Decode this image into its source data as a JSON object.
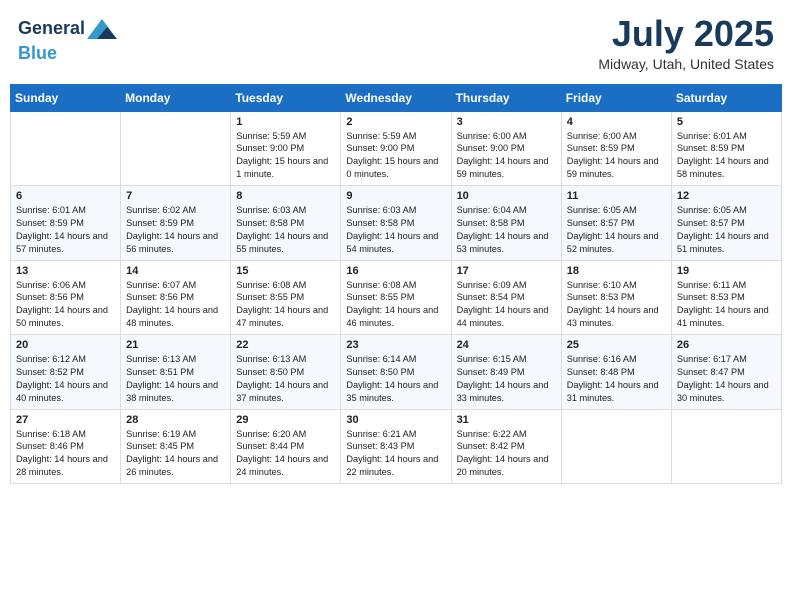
{
  "header": {
    "logo_line1": "General",
    "logo_line2": "Blue",
    "month_title": "July 2025",
    "location": "Midway, Utah, United States"
  },
  "weekdays": [
    "Sunday",
    "Monday",
    "Tuesday",
    "Wednesday",
    "Thursday",
    "Friday",
    "Saturday"
  ],
  "weeks": [
    [
      {
        "day": "",
        "sunrise": "",
        "sunset": "",
        "daylight": ""
      },
      {
        "day": "",
        "sunrise": "",
        "sunset": "",
        "daylight": ""
      },
      {
        "day": "1",
        "sunrise": "Sunrise: 5:59 AM",
        "sunset": "Sunset: 9:00 PM",
        "daylight": "Daylight: 15 hours and 1 minute."
      },
      {
        "day": "2",
        "sunrise": "Sunrise: 5:59 AM",
        "sunset": "Sunset: 9:00 PM",
        "daylight": "Daylight: 15 hours and 0 minutes."
      },
      {
        "day": "3",
        "sunrise": "Sunrise: 6:00 AM",
        "sunset": "Sunset: 9:00 PM",
        "daylight": "Daylight: 14 hours and 59 minutes."
      },
      {
        "day": "4",
        "sunrise": "Sunrise: 6:00 AM",
        "sunset": "Sunset: 8:59 PM",
        "daylight": "Daylight: 14 hours and 59 minutes."
      },
      {
        "day": "5",
        "sunrise": "Sunrise: 6:01 AM",
        "sunset": "Sunset: 8:59 PM",
        "daylight": "Daylight: 14 hours and 58 minutes."
      }
    ],
    [
      {
        "day": "6",
        "sunrise": "Sunrise: 6:01 AM",
        "sunset": "Sunset: 8:59 PM",
        "daylight": "Daylight: 14 hours and 57 minutes."
      },
      {
        "day": "7",
        "sunrise": "Sunrise: 6:02 AM",
        "sunset": "Sunset: 8:59 PM",
        "daylight": "Daylight: 14 hours and 56 minutes."
      },
      {
        "day": "8",
        "sunrise": "Sunrise: 6:03 AM",
        "sunset": "Sunset: 8:58 PM",
        "daylight": "Daylight: 14 hours and 55 minutes."
      },
      {
        "day": "9",
        "sunrise": "Sunrise: 6:03 AM",
        "sunset": "Sunset: 8:58 PM",
        "daylight": "Daylight: 14 hours and 54 minutes."
      },
      {
        "day": "10",
        "sunrise": "Sunrise: 6:04 AM",
        "sunset": "Sunset: 8:58 PM",
        "daylight": "Daylight: 14 hours and 53 minutes."
      },
      {
        "day": "11",
        "sunrise": "Sunrise: 6:05 AM",
        "sunset": "Sunset: 8:57 PM",
        "daylight": "Daylight: 14 hours and 52 minutes."
      },
      {
        "day": "12",
        "sunrise": "Sunrise: 6:05 AM",
        "sunset": "Sunset: 8:57 PM",
        "daylight": "Daylight: 14 hours and 51 minutes."
      }
    ],
    [
      {
        "day": "13",
        "sunrise": "Sunrise: 6:06 AM",
        "sunset": "Sunset: 8:56 PM",
        "daylight": "Daylight: 14 hours and 50 minutes."
      },
      {
        "day": "14",
        "sunrise": "Sunrise: 6:07 AM",
        "sunset": "Sunset: 8:56 PM",
        "daylight": "Daylight: 14 hours and 48 minutes."
      },
      {
        "day": "15",
        "sunrise": "Sunrise: 6:08 AM",
        "sunset": "Sunset: 8:55 PM",
        "daylight": "Daylight: 14 hours and 47 minutes."
      },
      {
        "day": "16",
        "sunrise": "Sunrise: 6:08 AM",
        "sunset": "Sunset: 8:55 PM",
        "daylight": "Daylight: 14 hours and 46 minutes."
      },
      {
        "day": "17",
        "sunrise": "Sunrise: 6:09 AM",
        "sunset": "Sunset: 8:54 PM",
        "daylight": "Daylight: 14 hours and 44 minutes."
      },
      {
        "day": "18",
        "sunrise": "Sunrise: 6:10 AM",
        "sunset": "Sunset: 8:53 PM",
        "daylight": "Daylight: 14 hours and 43 minutes."
      },
      {
        "day": "19",
        "sunrise": "Sunrise: 6:11 AM",
        "sunset": "Sunset: 8:53 PM",
        "daylight": "Daylight: 14 hours and 41 minutes."
      }
    ],
    [
      {
        "day": "20",
        "sunrise": "Sunrise: 6:12 AM",
        "sunset": "Sunset: 8:52 PM",
        "daylight": "Daylight: 14 hours and 40 minutes."
      },
      {
        "day": "21",
        "sunrise": "Sunrise: 6:13 AM",
        "sunset": "Sunset: 8:51 PM",
        "daylight": "Daylight: 14 hours and 38 minutes."
      },
      {
        "day": "22",
        "sunrise": "Sunrise: 6:13 AM",
        "sunset": "Sunset: 8:50 PM",
        "daylight": "Daylight: 14 hours and 37 minutes."
      },
      {
        "day": "23",
        "sunrise": "Sunrise: 6:14 AM",
        "sunset": "Sunset: 8:50 PM",
        "daylight": "Daylight: 14 hours and 35 minutes."
      },
      {
        "day": "24",
        "sunrise": "Sunrise: 6:15 AM",
        "sunset": "Sunset: 8:49 PM",
        "daylight": "Daylight: 14 hours and 33 minutes."
      },
      {
        "day": "25",
        "sunrise": "Sunrise: 6:16 AM",
        "sunset": "Sunset: 8:48 PM",
        "daylight": "Daylight: 14 hours and 31 minutes."
      },
      {
        "day": "26",
        "sunrise": "Sunrise: 6:17 AM",
        "sunset": "Sunset: 8:47 PM",
        "daylight": "Daylight: 14 hours and 30 minutes."
      }
    ],
    [
      {
        "day": "27",
        "sunrise": "Sunrise: 6:18 AM",
        "sunset": "Sunset: 8:46 PM",
        "daylight": "Daylight: 14 hours and 28 minutes."
      },
      {
        "day": "28",
        "sunrise": "Sunrise: 6:19 AM",
        "sunset": "Sunset: 8:45 PM",
        "daylight": "Daylight: 14 hours and 26 minutes."
      },
      {
        "day": "29",
        "sunrise": "Sunrise: 6:20 AM",
        "sunset": "Sunset: 8:44 PM",
        "daylight": "Daylight: 14 hours and 24 minutes."
      },
      {
        "day": "30",
        "sunrise": "Sunrise: 6:21 AM",
        "sunset": "Sunset: 8:43 PM",
        "daylight": "Daylight: 14 hours and 22 minutes."
      },
      {
        "day": "31",
        "sunrise": "Sunrise: 6:22 AM",
        "sunset": "Sunset: 8:42 PM",
        "daylight": "Daylight: 14 hours and 20 minutes."
      },
      {
        "day": "",
        "sunrise": "",
        "sunset": "",
        "daylight": ""
      },
      {
        "day": "",
        "sunrise": "",
        "sunset": "",
        "daylight": ""
      }
    ]
  ]
}
